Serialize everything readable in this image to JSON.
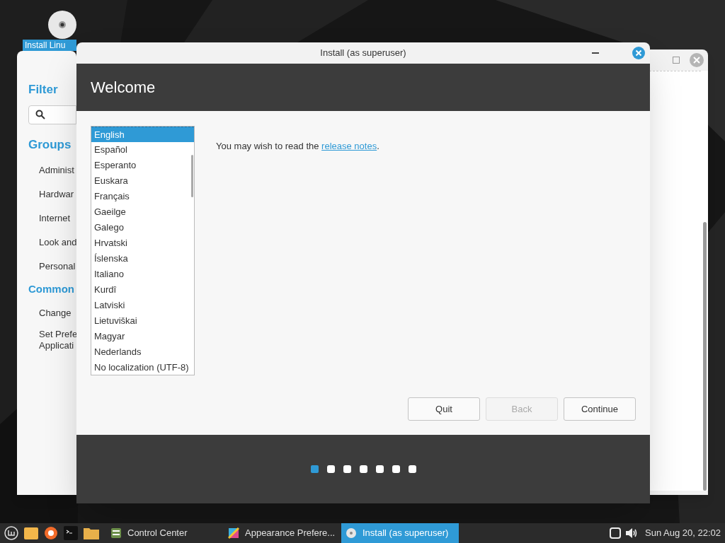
{
  "desktop_icon": {
    "label": "Install Linu"
  },
  "control_center": {
    "filter_title": "Filter",
    "groups_title": "Groups",
    "groups": [
      "Administ",
      "Hardwar",
      "Internet",
      "Look and",
      "Personal"
    ],
    "common_title": "Common",
    "common": [
      [
        "Change"
      ],
      [
        "Set Prefe",
        "Applicati"
      ]
    ]
  },
  "installer": {
    "title": "Install (as superuser)",
    "heading": "Welcome",
    "languages": [
      {
        "name": "English",
        "selected": true
      },
      {
        "name": "Español",
        "selected": false
      },
      {
        "name": "Esperanto",
        "selected": false
      },
      {
        "name": "Euskara",
        "selected": false
      },
      {
        "name": "Français",
        "selected": false
      },
      {
        "name": "Gaeilge",
        "selected": false
      },
      {
        "name": "Galego",
        "selected": false
      },
      {
        "name": "Hrvatski",
        "selected": false
      },
      {
        "name": "Íslenska",
        "selected": false
      },
      {
        "name": "Italiano",
        "selected": false
      },
      {
        "name": "Kurdî",
        "selected": false
      },
      {
        "name": "Latviski",
        "selected": false
      },
      {
        "name": "Lietuviškai",
        "selected": false
      },
      {
        "name": "Magyar",
        "selected": false
      },
      {
        "name": "Nederlands",
        "selected": false
      },
      {
        "name": "No localization (UTF-8)",
        "selected": false
      }
    ],
    "message": {
      "before": "You may wish to read the ",
      "link": "release notes",
      "after": "."
    },
    "buttons": [
      {
        "label": "Quit",
        "disabled": false
      },
      {
        "label": "Back",
        "disabled": true
      },
      {
        "label": "Continue",
        "disabled": false
      }
    ],
    "steps": [
      {
        "selected": true
      },
      {
        "selected": false
      },
      {
        "selected": false
      },
      {
        "selected": false
      },
      {
        "selected": false
      },
      {
        "selected": false
      },
      {
        "selected": false
      }
    ]
  },
  "taskbar": {
    "tasks": [
      {
        "label": "Control Center",
        "selected": false
      },
      {
        "label": "Appearance Prefere...",
        "selected": false
      },
      {
        "label": "Install (as superuser)",
        "selected": true
      }
    ],
    "clock": "Sun Aug 20, 22:02"
  }
}
